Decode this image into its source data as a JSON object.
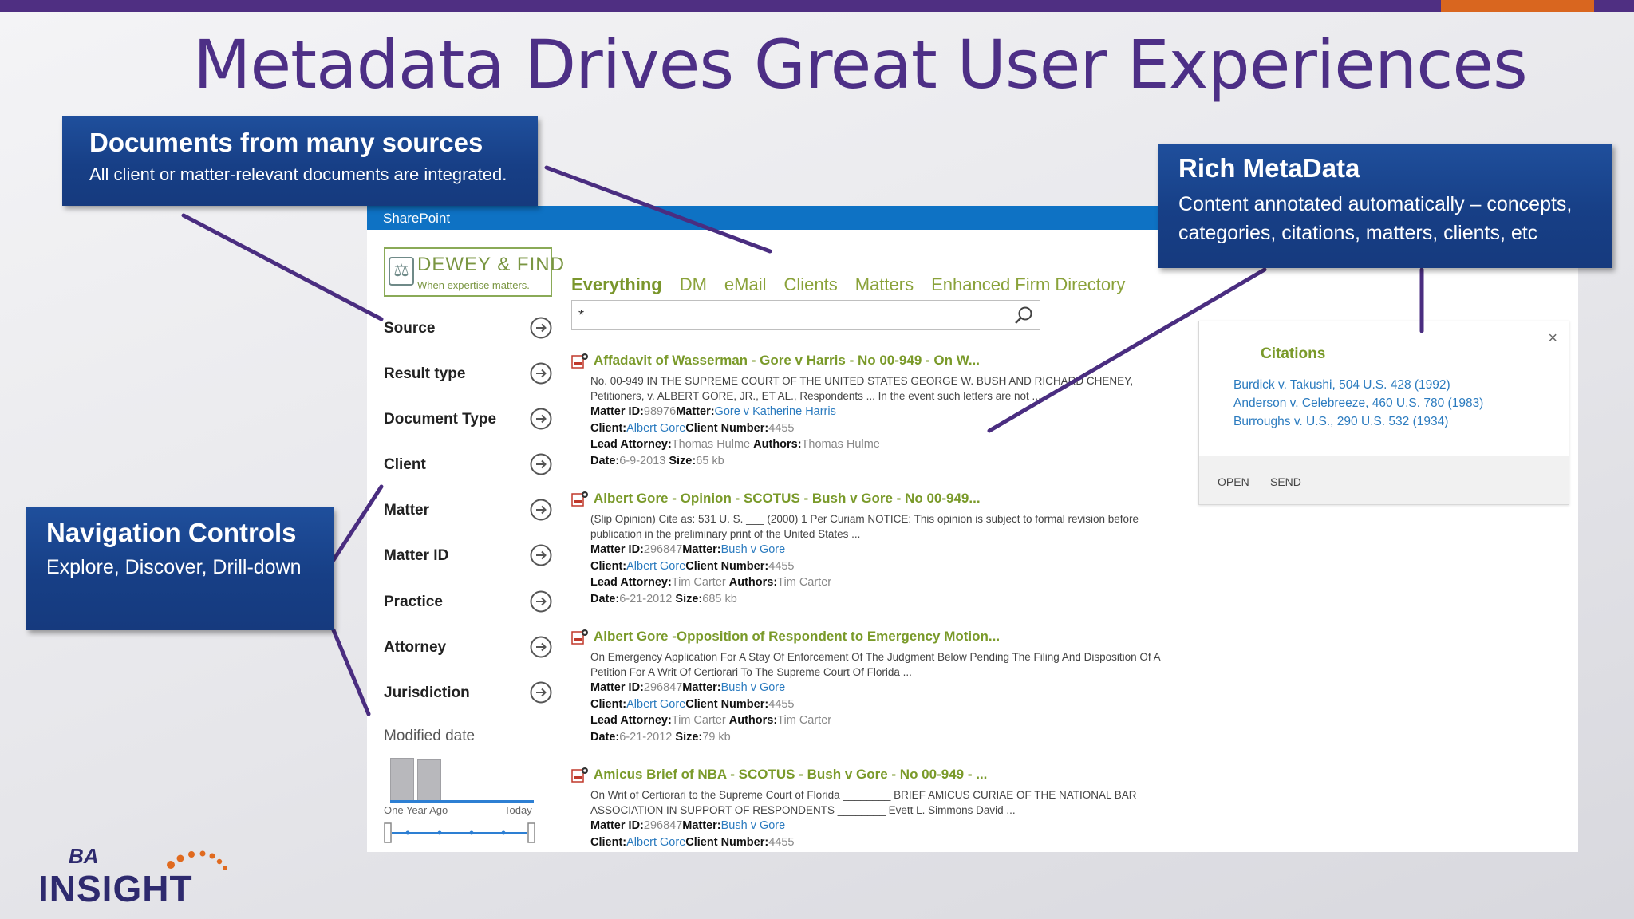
{
  "slide": {
    "title": "Metadata Drives Great User Experiences",
    "accent_color": "#4f2f82",
    "secondary_accent": "#d9661f"
  },
  "sharepoint": {
    "bar_label": "SharePoint",
    "bar_color": "#0e72c4",
    "logo": {
      "title": "DEWEY & FIND",
      "tagline": "When expertise matters."
    },
    "tabs": [
      {
        "label": "Everything",
        "active": true
      },
      {
        "label": "DM",
        "active": false
      },
      {
        "label": "eMail",
        "active": false
      },
      {
        "label": "Clients",
        "active": false
      },
      {
        "label": "Matters",
        "active": false
      },
      {
        "label": "Enhanced Firm Directory",
        "active": false
      }
    ],
    "search": {
      "value": "*"
    },
    "refiners": [
      "Source",
      "Result type",
      "Document Type",
      "Client",
      "Matter",
      "Matter ID",
      "Practice",
      "Attorney",
      "Jurisdiction"
    ],
    "modified_date": {
      "label": "Modified date",
      "from_label": "One Year Ago",
      "to_label": "Today"
    },
    "results": [
      {
        "title": "Affadavit of Wasserman - Gore v Harris - No 00-949 - On W...",
        "summary": "No. 00-949 IN THE SUPREME COURT OF THE UNITED STATES GEORGE W. BUSH AND RICHARD CHENEY, Petitioners, v. ALBERT GORE, JR., ET AL., Respondents ... In the event such letters are not ...",
        "matter_id": "98976",
        "matter": "Gore v Katherine Harris",
        "client": "Albert Gore",
        "client_number": "4455",
        "lead_attorney": "Thomas Hulme",
        "authors": "Thomas Hulme",
        "date": "6-9-2013",
        "size": "65 kb"
      },
      {
        "title": "Albert Gore - Opinion - SCOTUS - Bush v Gore - No 00-949...",
        "summary": "(Slip Opinion) Cite as: 531 U. S. ___ (2000) 1 Per Curiam NOTICE: This opinion is subject to formal revision before publication in the preliminary print of the United States ...",
        "matter_id": "296847",
        "matter": "Bush v Gore",
        "client": "Albert Gore",
        "client_number": "4455",
        "lead_attorney": "Tim Carter",
        "authors": "Tim Carter",
        "date": "6-21-2012",
        "size": "685 kb"
      },
      {
        "title": "Albert Gore -Opposition of Respondent to Emergency Motion...",
        "summary": "On Emergency Application For A Stay Of Enforcement Of The Judgment Below Pending The Filing And Disposition Of A Petition For A Writ Of Certiorari To The Supreme Court Of Florida ...",
        "matter_id": "296847",
        "matter": "Bush v Gore",
        "client": "Albert Gore",
        "client_number": "4455",
        "lead_attorney": "Tim Carter",
        "authors": "Tim Carter",
        "date": "6-21-2012",
        "size": "79 kb"
      },
      {
        "title": "Amicus Brief of NBA - SCOTUS - Bush v Gore - No 00-949 - ...",
        "summary": "On Writ of Certiorari to the Supreme Court of Florida ________ BRIEF AMICUS CURIAE OF THE NATIONAL BAR ASSOCIATION IN SUPPORT OF RESPONDENTS ________ Evett L. Simmons David ...",
        "matter_id": "296847",
        "matter": "Bush v Gore",
        "client": "Albert Gore",
        "client_number": "4455"
      }
    ],
    "meta_labels": {
      "matter_id": "Matter ID:",
      "matter": "Matter:",
      "client": "Client:",
      "client_number": "Client Number:",
      "lead_attorney": "Lead Attorney:",
      "authors": "Authors:",
      "date": "Date:",
      "size": "Size:"
    }
  },
  "callout": {
    "close": "×",
    "heading": "Citations",
    "citations": [
      "Burdick v. Takushi, 504 U.S. 428 (1992)",
      "Anderson v. Celebreeze, 460 U.S. 780 (1983)",
      "Burroughs v. U.S., 290 U.S. 532 (1934)"
    ],
    "open_label": "OPEN",
    "send_label": "SEND"
  },
  "notes": {
    "sources": {
      "title": "Documents from many sources",
      "text": "All client or matter-relevant documents are integrated."
    },
    "metadata": {
      "title": "Rich MetaData",
      "line1": "Content annotated automatically – concepts,",
      "line2": "categories, citations, matters, clients, etc"
    },
    "navigation": {
      "title": "Navigation Controls",
      "text": "Explore, Discover, Drill-down"
    }
  },
  "brand": {
    "line1": "BA",
    "line2": "INSIGHT"
  }
}
